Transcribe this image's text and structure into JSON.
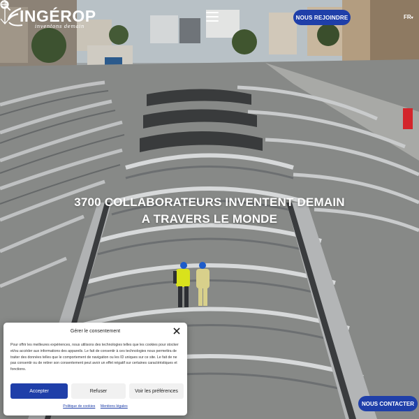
{
  "header": {
    "logo_word": "INGÉROP",
    "logo_tagline": "inventons demain",
    "join_label": "NOUS REJOINDRE",
    "language": "FR",
    "icons": [
      "menu-icon",
      "search-icon",
      "globe-icon",
      "chevron-down-icon"
    ]
  },
  "hero": {
    "headline_line1": "3700 COLLABORATEURS INVENTENT DEMAIN",
    "headline_line2": "A TRAVERS LE MONDE"
  },
  "consent": {
    "title": "Gérer le consentement",
    "body": "Pour offrir les meilleures expériences, nous utilisons des technologies telles que les cookies pour stocker et/ou accéder aux informations des appareils. Le fait de consentir à ces technologies nous permettra de traiter des données telles que le comportement de navigation ou les ID uniques sur ce site. Le fait de ne pas consentir ou de retirer son consentement peut avoir un effet négatif sur certaines caractéristiques et fonctions.",
    "accept_label": "Accepter",
    "refuse_label": "Refuser",
    "prefs_label": "Voir les préférences",
    "cookies_link": "Politique de cookies",
    "legal_link": "Mentions légales"
  },
  "contact_label": "NOUS CONTACTER",
  "colors": {
    "brand_blue": "#1f3fa9",
    "text_white": "#ffffff"
  }
}
